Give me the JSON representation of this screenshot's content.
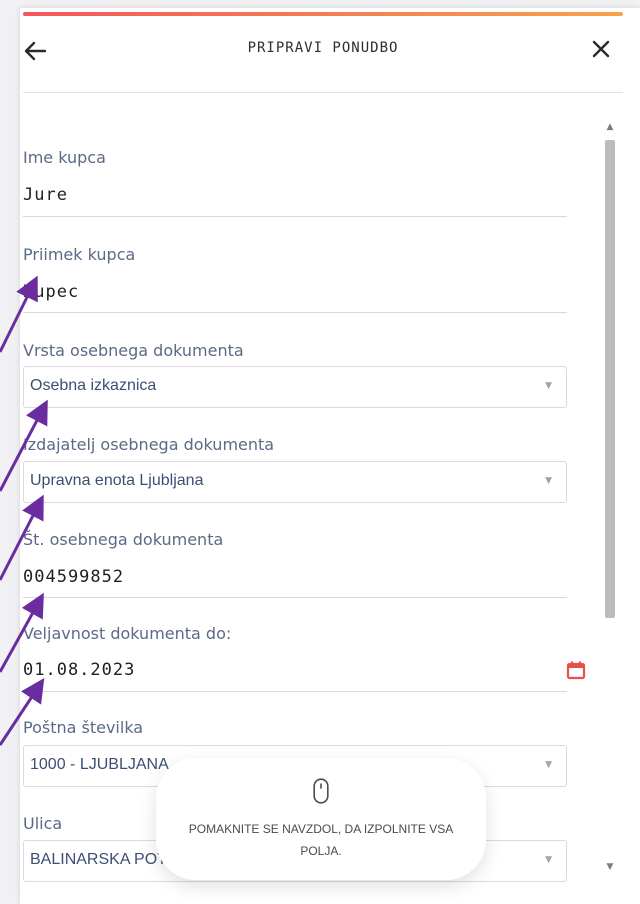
{
  "colors": {
    "accent_start": "#f2575c",
    "accent_end": "#f6a24e",
    "calendar": "#e8504d",
    "annotation_arrow": "#6a2d9f"
  },
  "header": {
    "title": "PRIPRAVI PONUDBO",
    "back_icon": "arrow-left-icon",
    "close_icon": "close-icon"
  },
  "fields": {
    "first_name": {
      "label": "Ime kupca",
      "value": "Jure"
    },
    "last_name": {
      "label": "Priimek kupca",
      "value": "Kupec"
    },
    "document_type": {
      "label": "Vrsta osebnega dokumenta",
      "value": "Osebna izkaznica"
    },
    "document_issuer": {
      "label": "Izdajatelj osebnega dokumenta",
      "value": "Upravna enota Ljubljana"
    },
    "document_number": {
      "label": "Št. osebnega dokumenta",
      "value": "004599852"
    },
    "valid_until": {
      "label": "Veljavnost dokumenta do:",
      "value": "01.08.2023",
      "icon": "calendar-icon"
    },
    "postal_code": {
      "label": "Poštna številka",
      "value": "1000 - LJUBLJANA"
    },
    "street": {
      "label": "Ulica",
      "value": "BALINARSKA POT"
    }
  },
  "toast": {
    "icon": "mouse-icon",
    "text": "POMAKNITE SE NAVZDOL, DA IZPOLNITE VSA POLJA."
  }
}
